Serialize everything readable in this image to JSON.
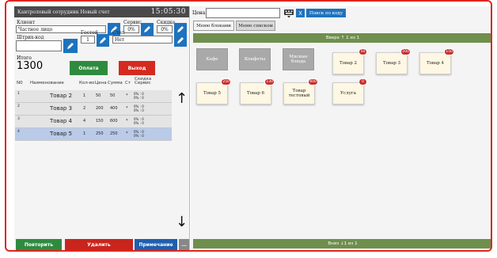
{
  "header": {
    "title": "Кантроловый сотрудник  Новый счет",
    "clock": "15:05:30"
  },
  "form": {
    "client_label": "Клиент",
    "client_value": "Частное лицо",
    "service_label": "Сервис",
    "service_value": "0%",
    "discount_label": "Скидка",
    "discount_value": "0%",
    "barcode_label": "Штрих-код",
    "guests_label": "Гостей",
    "guests_value": "1",
    "table_label": "Стол",
    "table_value": "Нет",
    "total_label": "Итого",
    "total_value": "1300",
    "pay_label": "Оплата",
    "exit_label": "Выход"
  },
  "table": {
    "headers": {
      "no": "N0",
      "name": "Наименование",
      "qty": "Кол-во",
      "price": "Цена",
      "sum": "Сумма",
      "st": "Ст",
      "disc": "Скидка Сервис"
    },
    "rows": [
      {
        "idx": "1",
        "name": "Товар 2",
        "qty": "1",
        "price": "50",
        "sum": "50",
        "st": "*",
        "disc1": "0% : 0",
        "disc2": "0% : 0"
      },
      {
        "idx": "2",
        "name": "Товар 3",
        "qty": "2",
        "price": "200",
        "sum": "400",
        "st": "*",
        "disc1": "0% : 0",
        "disc2": "0% : 0"
      },
      {
        "idx": "3",
        "name": "Товар 4",
        "qty": "4",
        "price": "150",
        "sum": "600",
        "st": "*",
        "disc1": "0% : 0",
        "disc2": "0% : 0"
      },
      {
        "idx": "4",
        "name": "Товар 5",
        "qty": "1",
        "price": "250",
        "sum": "250",
        "st": "*",
        "disc1": "0% : 0",
        "disc2": "0% : 0"
      }
    ]
  },
  "bottom": {
    "repeat": "Повторить",
    "delete": "Удалить",
    "note": "Примечание",
    "more": "..."
  },
  "right": {
    "search_label": "Цена",
    "search_placeholder": "",
    "clear": "X",
    "code_search": "Поиск по коду",
    "tab_blocks": "Меню блоками",
    "tab_list": "Меню списком",
    "page_up": "Вверх ↑ 1 из 1",
    "page_down": "Вниз ↓1 из 1",
    "tiles": [
      {
        "label": "Кафе",
        "kind": "cat",
        "badge": ""
      },
      {
        "label": "Конфеты",
        "kind": "cat",
        "badge": ""
      },
      {
        "label": "Мясные блюда",
        "kind": "cat",
        "badge": ""
      },
      {
        "label": "Товар 2",
        "kind": "item",
        "badge": "50"
      },
      {
        "label": "Товар 3",
        "kind": "item",
        "badge": "200"
      },
      {
        "label": "Товар 4",
        "kind": "item",
        "badge": "150"
      },
      {
        "label": "Товар 5",
        "kind": "item",
        "badge": "250"
      },
      {
        "label": "Товар 6",
        "kind": "item",
        "badge": "130"
      },
      {
        "label": "Товар тестовый",
        "kind": "item",
        "badge": "600"
      },
      {
        "label": "Услуга",
        "kind": "item",
        "badge": "0"
      }
    ]
  },
  "colors": {
    "accent": "#1e73be",
    "pay": "#2e8b3e",
    "exit": "#d42a1f",
    "pager": "#6e8f4d",
    "selected_row": "#b9cbe8",
    "frame": "#e0261f"
  }
}
